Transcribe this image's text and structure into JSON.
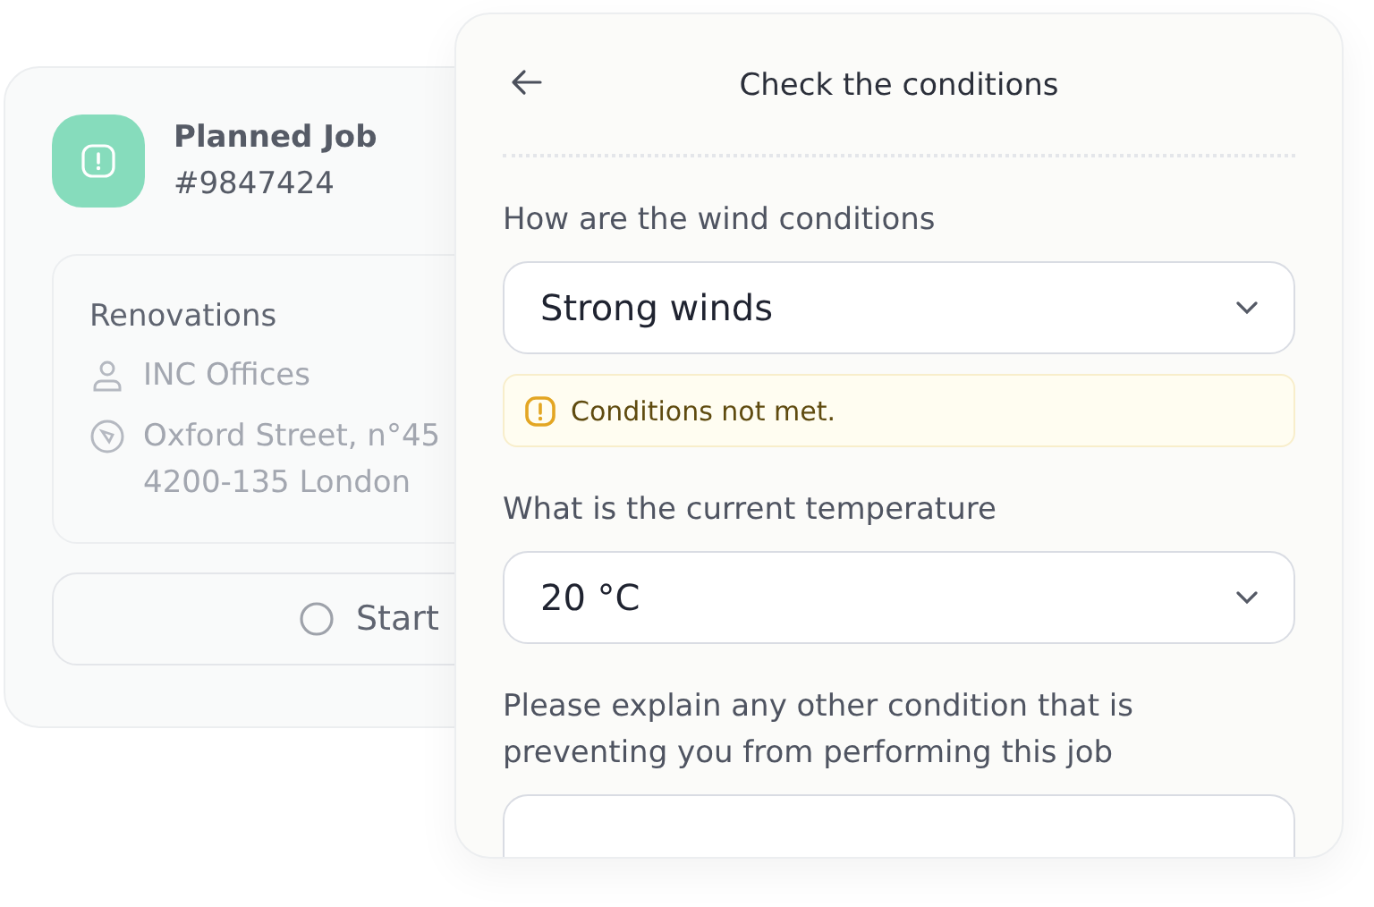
{
  "job_card": {
    "title": "Planned Job",
    "number": "#9847424",
    "details": {
      "title": "Renovations",
      "client": "INC Offices",
      "address_lines": [
        "Oxford Street, n°45",
        "4200-135 London"
      ]
    },
    "start_button": {
      "label": "Start"
    }
  },
  "dialog": {
    "title": "Check the conditions",
    "fields": [
      {
        "kind": "select",
        "label": "How are the wind conditions",
        "value": "Strong winds",
        "warning": "Conditions not met."
      },
      {
        "kind": "select",
        "label": "What is the current temperature",
        "value": "20 °C"
      },
      {
        "kind": "textarea",
        "label": "Please explain any other condition that is preventing you from performing this job"
      }
    ]
  }
}
